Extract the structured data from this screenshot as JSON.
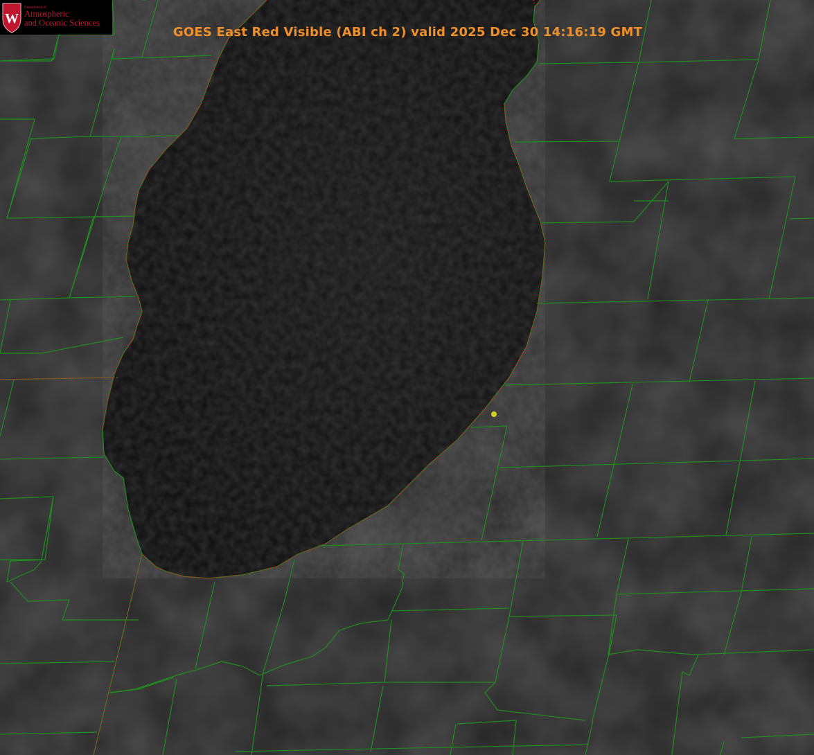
{
  "title": "GOES East Red Visible (ABI ch 2) valid 2025 Dec 30 14:16:19 GMT",
  "logo": {
    "department": "Department of",
    "line1": "Atmospheric",
    "line2": "and Oceanic Sciences",
    "seal_letter": "W"
  },
  "colors": {
    "county_lines": "#1f8f1f",
    "state_lines": "#d42020",
    "title": "#f0902a",
    "marker": "#d8d020",
    "logo_text": "#c0152f"
  },
  "layers": [
    "visible-satellite-imagery",
    "lake-michigan",
    "county-boundaries",
    "state-boundaries",
    "station-marker"
  ]
}
